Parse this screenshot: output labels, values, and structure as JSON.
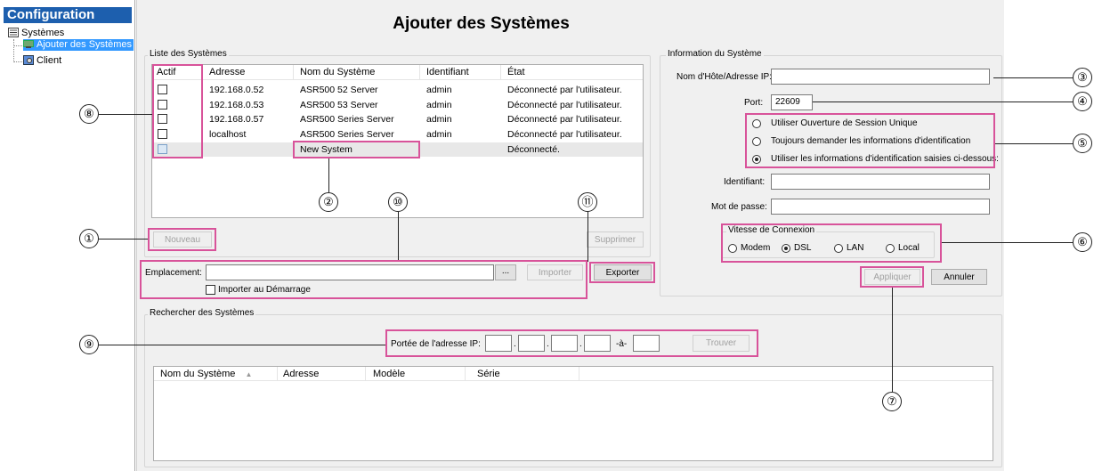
{
  "sidebar": {
    "title": "Configuration",
    "items": [
      {
        "label": "Systèmes"
      },
      {
        "label": "Ajouter des Systèmes"
      },
      {
        "label": "Client"
      }
    ]
  },
  "page_title": "Ajouter des Systèmes",
  "system_list": {
    "group_label": "Liste des Systèmes",
    "columns": [
      "Actif",
      "Adresse",
      "Nom du Système",
      "Identifiant",
      "État"
    ],
    "rows": [
      {
        "address": "192.168.0.52",
        "name": "ASR500 52 Server",
        "id": "admin",
        "state": "Déconnecté par l'utilisateur."
      },
      {
        "address": "192.168.0.53",
        "name": "ASR500 53 Server",
        "id": "admin",
        "state": "Déconnecté par l'utilisateur."
      },
      {
        "address": "192.168.0.57",
        "name": "ASR500 Series Server",
        "id": "admin",
        "state": "Déconnecté par l'utilisateur."
      },
      {
        "address": "localhost",
        "name": "ASR500 Series Server",
        "id": "admin",
        "state": "Déconnecté par l'utilisateur."
      },
      {
        "address": "",
        "name": "New System",
        "id": "",
        "state": "Déconnecté."
      }
    ],
    "new_button": "Nouveau",
    "delete_button": "Supprimer"
  },
  "location": {
    "label": "Emplacement:",
    "value": "",
    "browse": "...",
    "import_button": "Importer",
    "export_button": "Exporter",
    "import_on_start": "Importer au Démarrage"
  },
  "system_info": {
    "group_label": "Information du Système",
    "host_label": "Nom d'Hôte/Adresse IP:",
    "host_value": "",
    "port_label": "Port:",
    "port_value": "22609",
    "auth_options": [
      "Utiliser Ouverture de Session Unique",
      "Toujours demander les informations d'identification",
      "Utiliser les informations d'identification saisies ci-dessous:"
    ],
    "auth_selected": 2,
    "username_label": "Identifiant:",
    "password_label": "Mot de passe:",
    "speed_label": "Vitesse de Connexion",
    "speed_options": [
      "Modem",
      "DSL",
      "LAN",
      "Local"
    ],
    "speed_selected": 1,
    "apply_button": "Appliquer",
    "cancel_button": "Annuler"
  },
  "search": {
    "group_label": "Rechercher des Systèmes",
    "range_label": "Portée de l'adresse IP:",
    "to_label": "-à-",
    "find_button": "Trouver",
    "columns": [
      "Nom du Système",
      "Adresse",
      "Modèle",
      "Série"
    ]
  },
  "callouts": [
    "①",
    "②",
    "③",
    "④",
    "⑤",
    "⑥",
    "⑦",
    "⑧",
    "⑨",
    "⑩",
    "⑪"
  ],
  "colors": {
    "highlight": "#d8539a",
    "sidebar_title_bg": "#1d5fae",
    "selected_tree": "#3399ff"
  }
}
